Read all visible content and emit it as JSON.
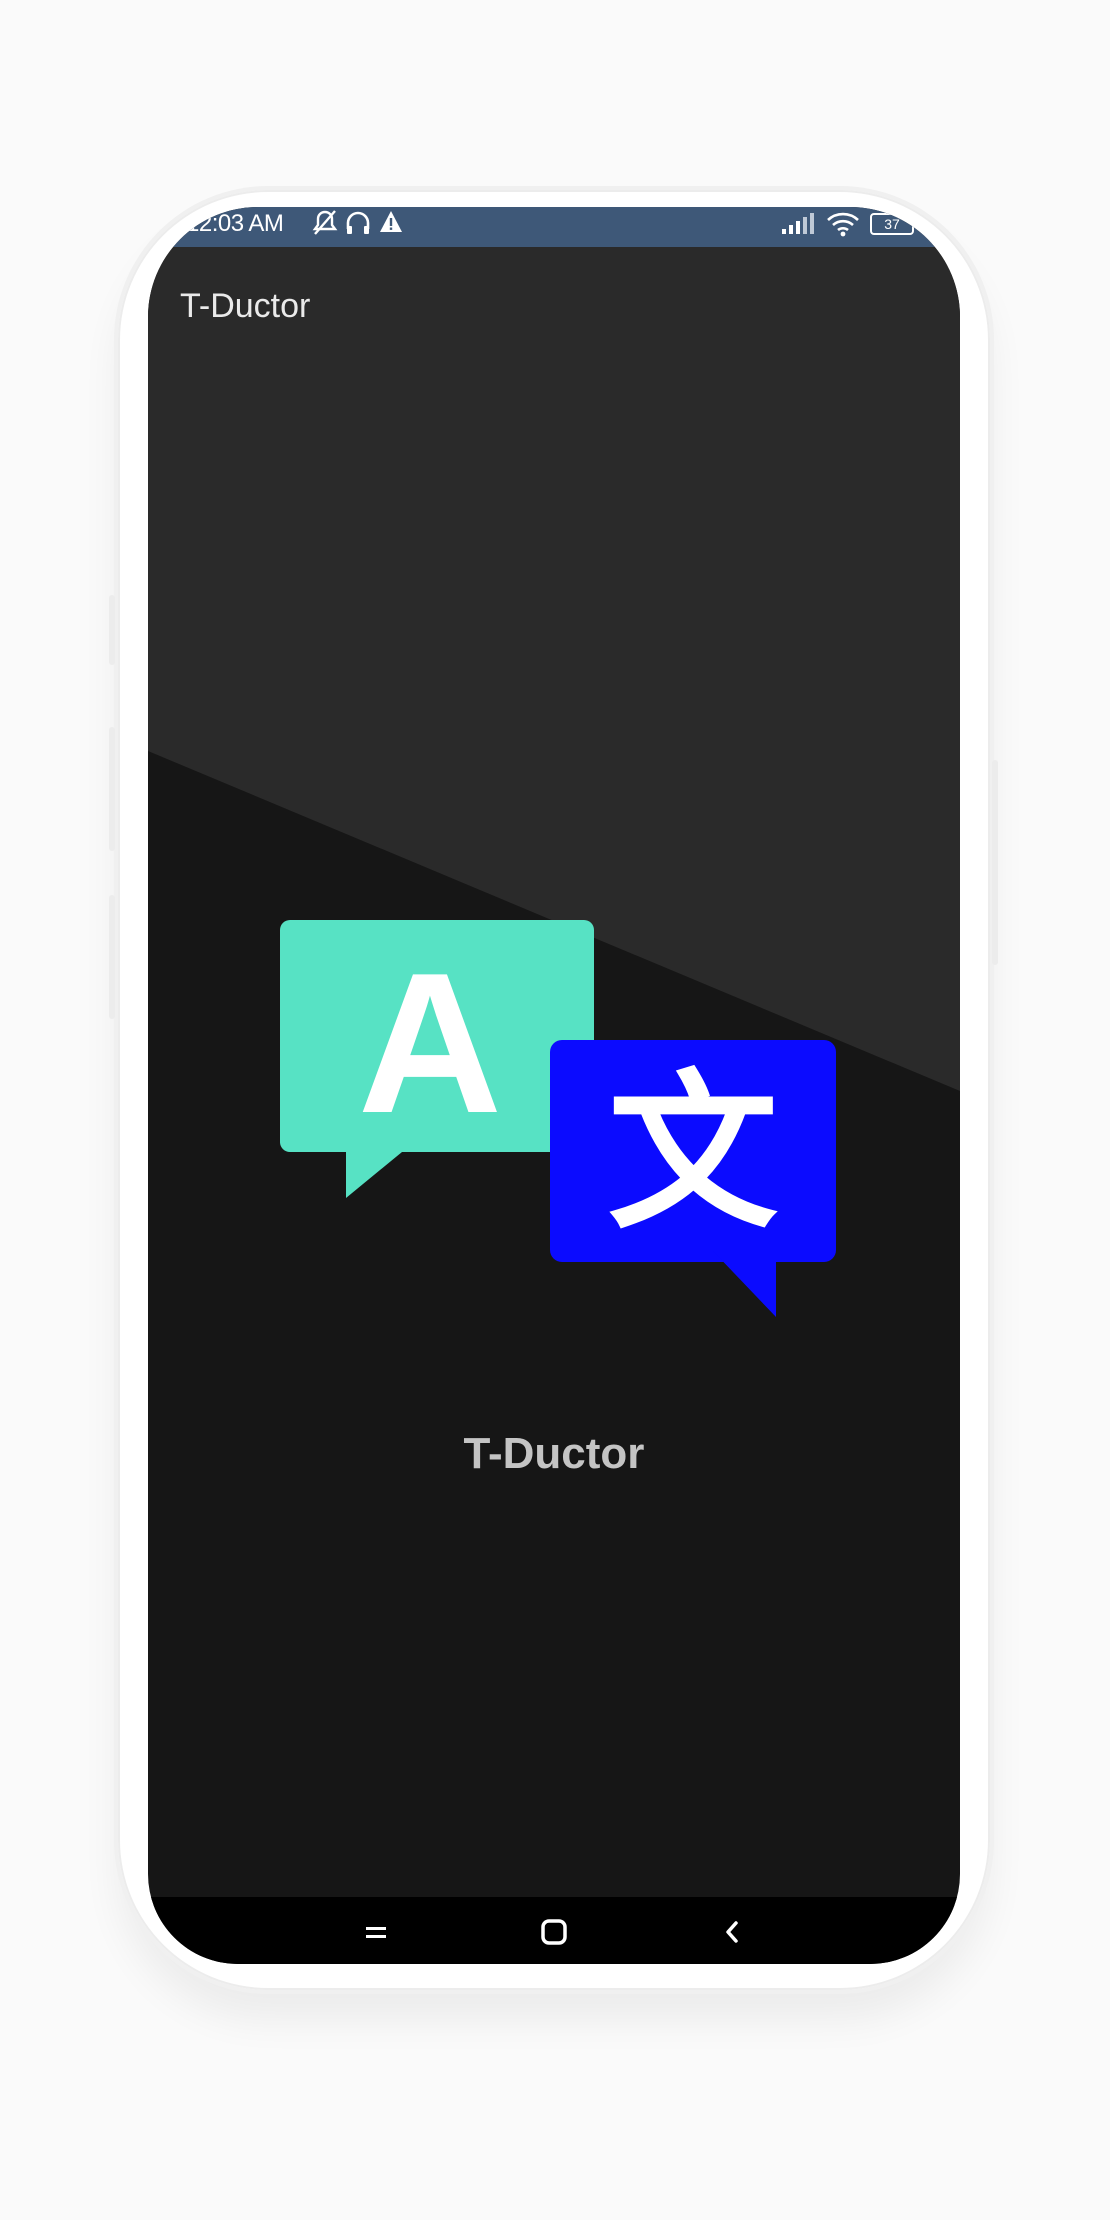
{
  "status_bar": {
    "time": "12:03 AM",
    "left_icons": [
      "notifications-off-icon",
      "headset-icon",
      "warning-icon"
    ],
    "right_icons": [
      "signal-icon",
      "wifi-icon",
      "battery-icon"
    ],
    "battery_level": "37"
  },
  "app_bar": {
    "title": "T-Ductor"
  },
  "splash": {
    "logo_letter_latin": "A",
    "logo_letter_cjk": "文",
    "title": "T-Ductor"
  },
  "colors": {
    "status_bar": "#3e5878",
    "background_light": "#2a2a2a",
    "background_dark": "#161616",
    "bubble_left": "#57e2c4",
    "bubble_right": "#0b0bff"
  },
  "nav_bar": {
    "buttons": [
      "recent-apps-icon",
      "home-icon",
      "back-icon"
    ]
  }
}
